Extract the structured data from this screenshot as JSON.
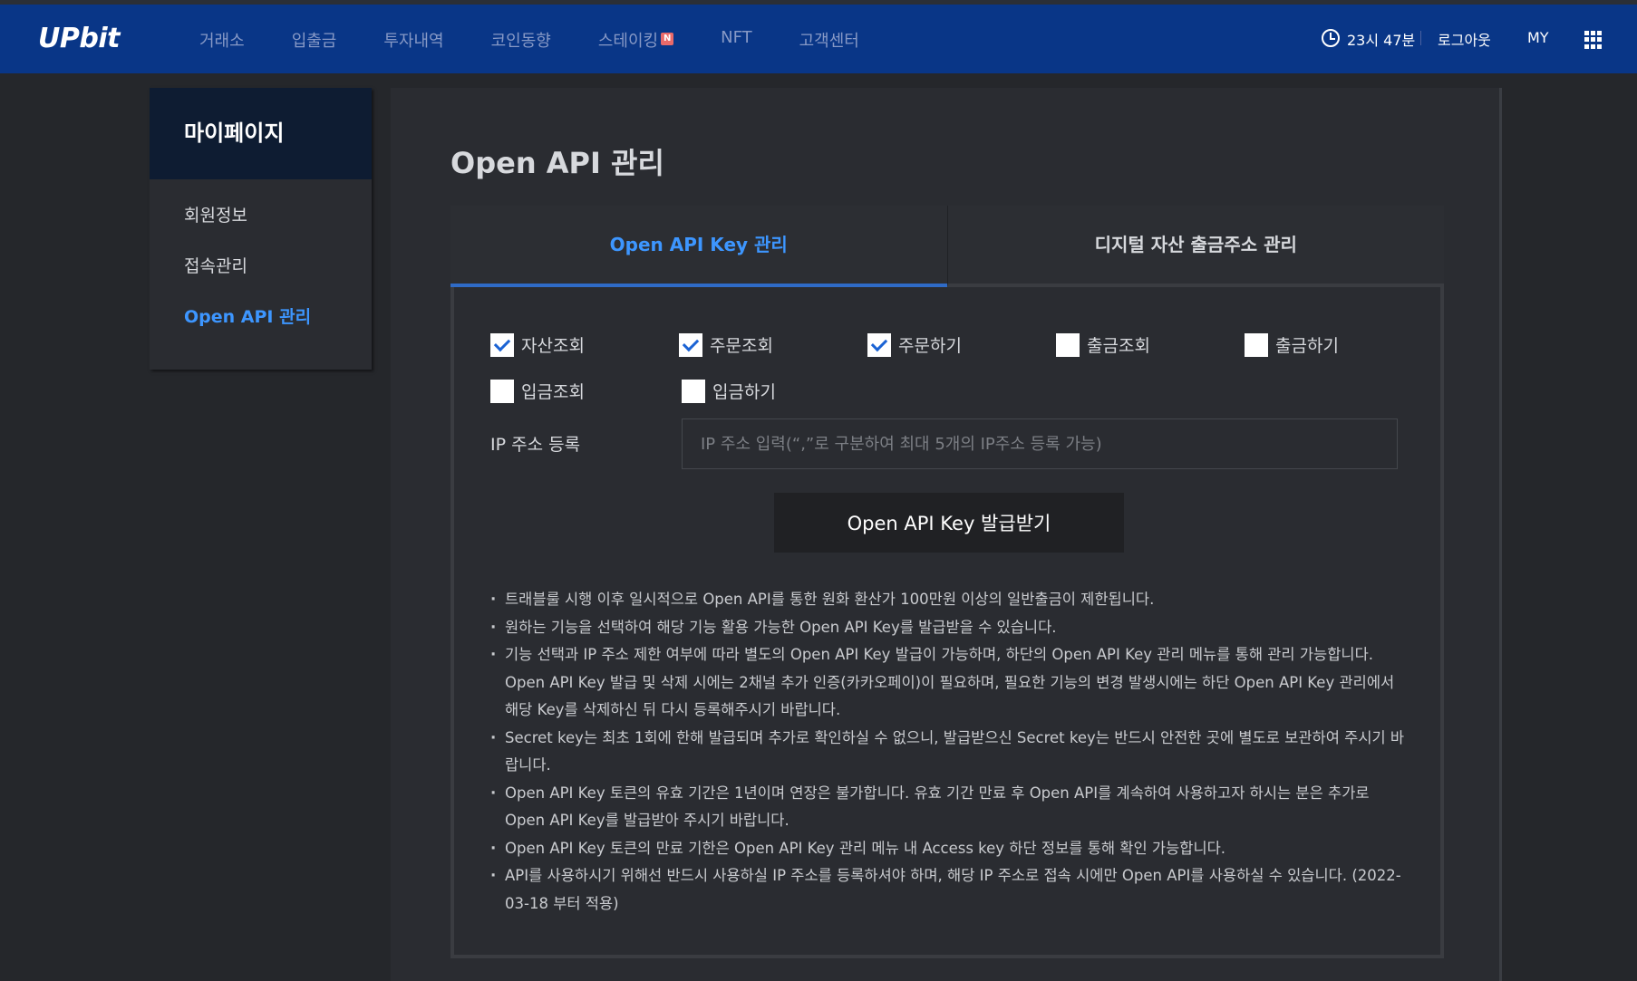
{
  "header": {
    "logo": "UPbit",
    "nav": [
      {
        "label": "거래소"
      },
      {
        "label": "입출금"
      },
      {
        "label": "투자내역"
      },
      {
        "label": "코인동향"
      },
      {
        "label": "스테이킹",
        "badge": "N"
      },
      {
        "label": "NFT"
      },
      {
        "label": "고객센터"
      }
    ],
    "time": "23시 47분",
    "logout": "로그아웃",
    "my": "MY"
  },
  "sidebar": {
    "title": "마이페이지",
    "items": [
      {
        "label": "회원정보"
      },
      {
        "label": "접속관리"
      },
      {
        "label": "Open API 관리",
        "active": true
      }
    ]
  },
  "main": {
    "title": "Open API 관리",
    "tabs": [
      {
        "label": "Open API Key 관리",
        "active": true
      },
      {
        "label": "디지털 자산 출금주소 관리"
      }
    ],
    "permissions": [
      {
        "label": "자산조회",
        "checked": true
      },
      {
        "label": "주문조회",
        "checked": true
      },
      {
        "label": "주문하기",
        "checked": true
      },
      {
        "label": "출금조회",
        "checked": false
      },
      {
        "label": "출금하기",
        "checked": false
      },
      {
        "label": "입금조회",
        "checked": false
      },
      {
        "label": "입금하기",
        "checked": false
      }
    ],
    "ip_label": "IP 주소 등록",
    "ip_placeholder": "IP 주소 입력(“,”로 구분하여 최대 5개의 IP주소 등록 가능)",
    "issue_button": "Open API Key 발급받기",
    "notes": [
      "트래블룰 시행 이후 일시적으로 Open API를 통한 원화 환산가 100만원 이상의 일반출금이 제한됩니다.",
      "원하는 기능을 선택하여 해당 기능 활용 가능한 Open API Key를 발급받을 수 있습니다.",
      "기능 선택과 IP 주소 제한 여부에 따라 별도의 Open API Key 발급이 가능하며, 하단의 Open API Key 관리 메뉴를 통해 관리 가능합니다. Open API Key 발급 및 삭제 시에는 2채널 추가 인증(카카오페이)이 필요하며, 필요한 기능의 변경 발생시에는 하단 Open API Key 관리에서 해당 Key를 삭제하신 뒤 다시 등록해주시기 바랍니다.",
      "Secret key는 최초 1회에 한해 발급되며 추가로 확인하실 수 없으니, 발급받으신 Secret key는 반드시 안전한 곳에 별도로 보관하여 주시기 바랍니다.",
      "Open API Key 토큰의 유효 기간은 1년이며 연장은 불가합니다. 유효 기간 만료 후 Open API를 계속하여 사용하고자 하시는 분은 추가로 Open API Key를 발급받아 주시기 바랍니다.",
      "Open API Key 토큰의 만료 기한은 Open API Key 관리 메뉴 내 Access key 하단 정보를 통해 확인 가능합니다.",
      "API를 사용하시기 위해선 반드시 사용하실 IP 주소를 등록하셔야 하며, 해당 IP 주소로 접속 시에만 Open API를 사용하실 수 있습니다. (2022-03-18 부터 적용)"
    ]
  },
  "colors": {
    "header_bg": "#093687",
    "accent": "#3d96ff",
    "page_bg": "#25272b",
    "panel_bg": "#2a2c31"
  }
}
